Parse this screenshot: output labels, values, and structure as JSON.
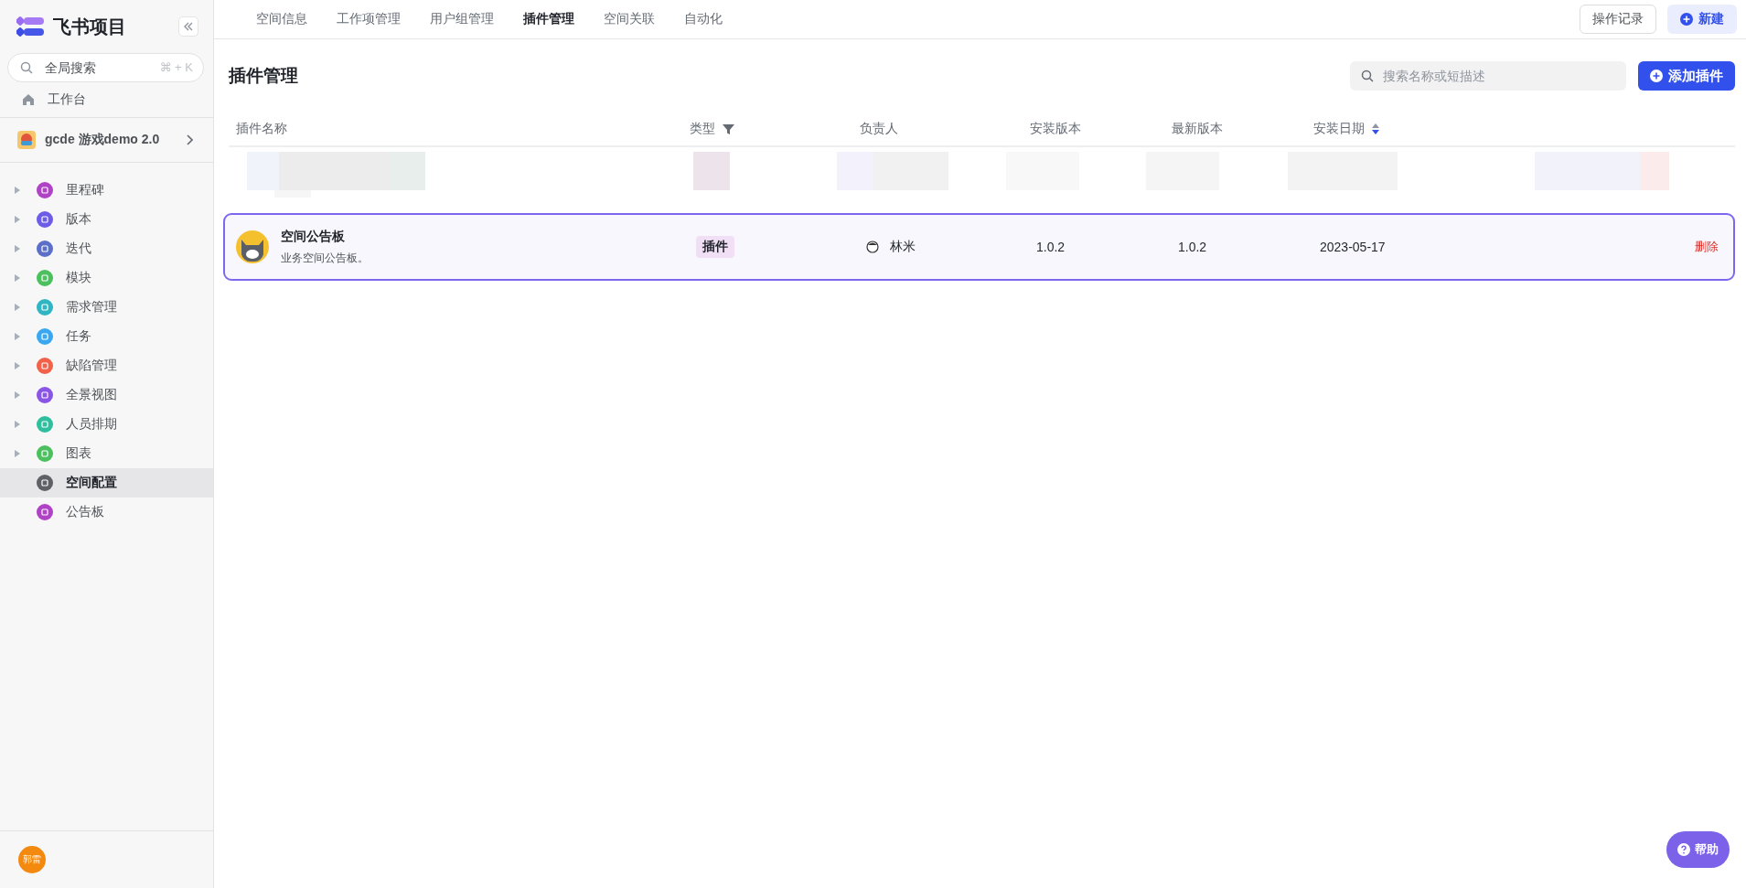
{
  "sidebar": {
    "brand": "飞书项目",
    "search": {
      "placeholder": "全局搜索",
      "shortcut": "⌘ + K"
    },
    "workbench": "工作台",
    "space": "gcde 游戏demo 2.0",
    "items": [
      {
        "label": "里程碑",
        "color": "#b043c5",
        "expandable": true,
        "selected": false
      },
      {
        "label": "版本",
        "color": "#6c5ce7",
        "expandable": true,
        "selected": false
      },
      {
        "label": "迭代",
        "color": "#5b6fc8",
        "expandable": true,
        "selected": false
      },
      {
        "label": "模块",
        "color": "#4cbf5e",
        "expandable": true,
        "selected": false
      },
      {
        "label": "需求管理",
        "color": "#2fb6c2",
        "expandable": true,
        "selected": false
      },
      {
        "label": "任务",
        "color": "#3aa8f0",
        "expandable": true,
        "selected": false
      },
      {
        "label": "缺陷管理",
        "color": "#f2624a",
        "expandable": true,
        "selected": false
      },
      {
        "label": "全景视图",
        "color": "#8a55e6",
        "expandable": true,
        "selected": false
      },
      {
        "label": "人员排期",
        "color": "#2fbf9f",
        "expandable": true,
        "selected": false
      },
      {
        "label": "图表",
        "color": "#4cbf5e",
        "expandable": true,
        "selected": false
      },
      {
        "label": "空间配置",
        "color": "#5f6066",
        "expandable": false,
        "selected": true
      },
      {
        "label": "公告板",
        "color": "#b043c5",
        "expandable": false,
        "selected": false
      }
    ],
    "user": "郭雷"
  },
  "tabs": [
    {
      "label": "空间信息",
      "selected": false
    },
    {
      "label": "工作项管理",
      "selected": false
    },
    {
      "label": "用户组管理",
      "selected": false
    },
    {
      "label": "插件管理",
      "selected": true
    },
    {
      "label": "空间关联",
      "selected": false
    },
    {
      "label": "自动化",
      "selected": false
    }
  ],
  "top_buttons": {
    "history": "操作记录",
    "create": "新建"
  },
  "page": {
    "title": "插件管理",
    "search": {
      "placeholder": "搜索名称或短描述"
    },
    "add_button": "添加插件"
  },
  "table": {
    "columns": [
      "插件名称",
      "类型",
      "负责人",
      "安装版本",
      "最新版本",
      "安装日期"
    ],
    "rows": [
      {
        "name": "空间公告板",
        "description": "业务空间公告板。",
        "type": "插件",
        "owner": "林米",
        "installed": "1.0.2",
        "latest": "1.0.2",
        "date": "2023-05-17",
        "action": "删除",
        "selected": true
      }
    ]
  },
  "help": "帮助"
}
